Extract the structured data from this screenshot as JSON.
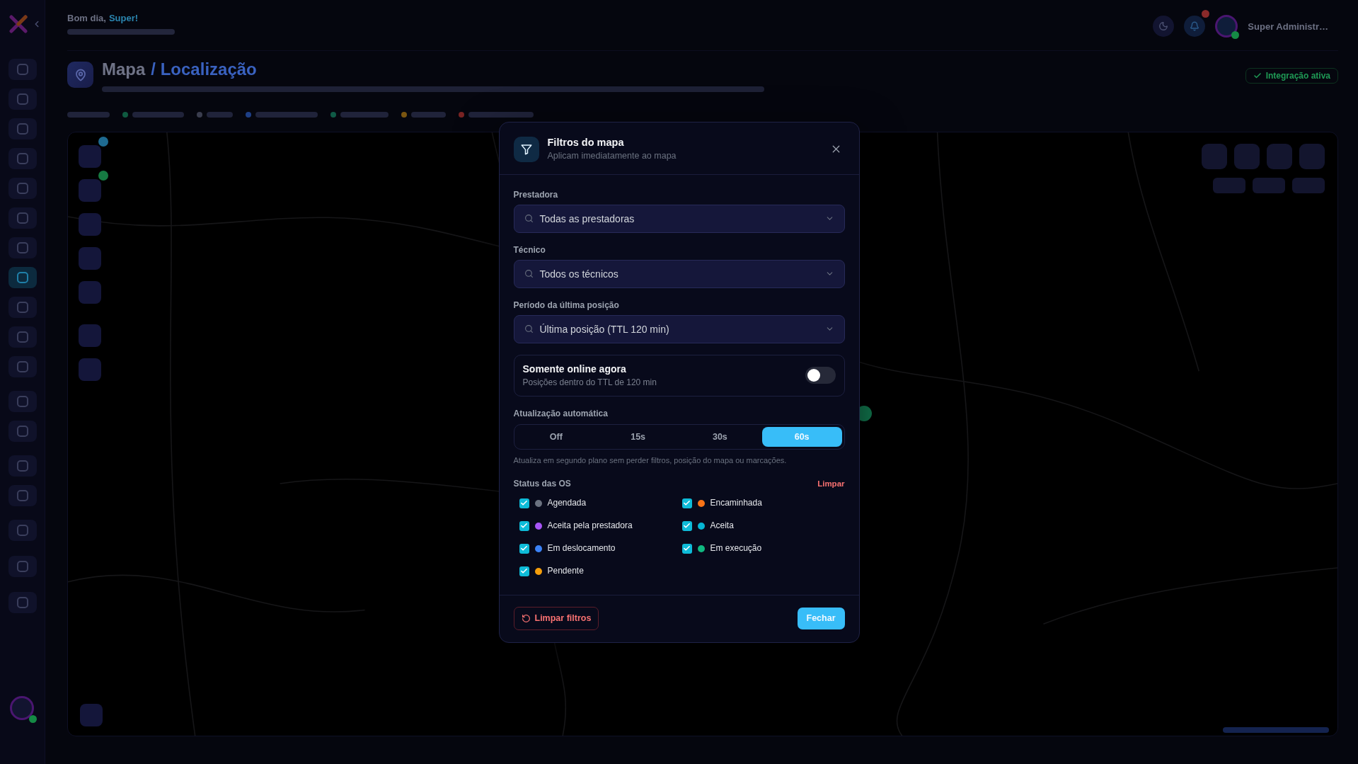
{
  "sidebar": {
    "items": [
      {
        "selected": false
      },
      {
        "selected": false
      },
      {
        "selected": false
      },
      {
        "selected": false
      },
      {
        "selected": false
      },
      {
        "selected": false
      },
      {
        "selected": false
      },
      {
        "selected": true
      },
      {
        "selected": false
      },
      {
        "selected": false
      },
      {
        "selected": false
      },
      {
        "selected": false
      },
      {
        "selected": false
      },
      {
        "selected": false
      },
      {
        "selected": false
      },
      {
        "selected": false
      },
      {
        "selected": false
      },
      {
        "selected": false
      }
    ]
  },
  "header": {
    "greeting": "Bom dia,",
    "greeting_name": "Super!",
    "user_name": "Super Administr…"
  },
  "page": {
    "title": "Mapa",
    "breadcrumb": "/ Localização",
    "integration_status": "Integração ativa",
    "legend": [
      {
        "color": "#0f5a40"
      },
      {
        "color": "#3a3d4e"
      },
      {
        "color": "#1e3f86"
      },
      {
        "color": "#0f5a46"
      },
      {
        "color": "#7a5510"
      },
      {
        "color": "#7a2424"
      }
    ]
  },
  "dialog": {
    "title": "Filtros do mapa",
    "subtitle": "Aplicam imediatamente ao mapa",
    "fields": [
      {
        "label": "Prestadora",
        "value": "Todas as prestadoras"
      },
      {
        "label": "Técnico",
        "value": "Todos os técnicos"
      },
      {
        "label": "Período da última posição",
        "value": "Última posição (TTL 120 min)"
      }
    ],
    "online_only": {
      "title": "Somente online agora",
      "description": "Posições dentro do TTL de 120 min",
      "on": false
    },
    "auto_refresh": {
      "label": "Atualização automática",
      "options": [
        {
          "label": "Off",
          "selected": false
        },
        {
          "label": "15s",
          "selected": false
        },
        {
          "label": "30s",
          "selected": false
        },
        {
          "label": "60s",
          "selected": true
        }
      ],
      "hint": "Atualiza em segundo plano sem perder filtros, posição do mapa ou marcações."
    },
    "status": {
      "label": "Status das OS",
      "clear": "Limpar",
      "items": [
        {
          "label": "Agendada",
          "checked": true,
          "color": "#6b7280"
        },
        {
          "label": "Encaminhada",
          "checked": true,
          "color": "#f97316"
        },
        {
          "label": "Aceita pela prestadora",
          "checked": true,
          "color": "#a855f7"
        },
        {
          "label": "Aceita",
          "checked": true,
          "color": "#06b6d4"
        },
        {
          "label": "Em deslocamento",
          "checked": true,
          "color": "#3b82f6"
        },
        {
          "label": "Em execução",
          "checked": true,
          "color": "#10b981"
        },
        {
          "label": "Pendente",
          "checked": true,
          "color": "#f59e0b"
        }
      ]
    },
    "buttons": {
      "reset": "Limpar filtros",
      "close": "Fechar"
    }
  }
}
